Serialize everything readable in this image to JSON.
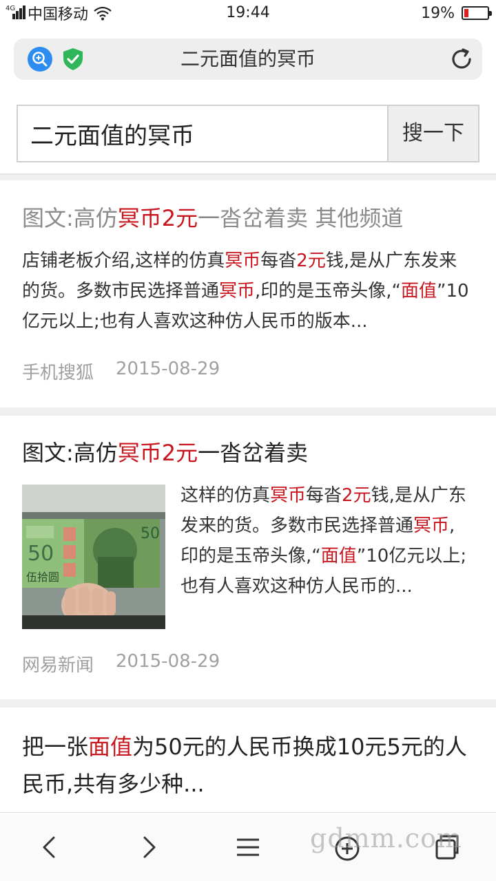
{
  "status_bar": {
    "network": "4G",
    "carrier": "中国移动",
    "time": "19:44",
    "battery_percent": "19%",
    "battery_level": 0.19
  },
  "address_bar": {
    "title": "二元面值的冥币"
  },
  "search": {
    "query": "二元面值的冥币",
    "button_label": "搜一下"
  },
  "results": [
    {
      "title_parts": [
        "图文:高仿",
        "冥币2元",
        "一沓岔着卖 其他频道"
      ],
      "snippet_parts": [
        "店铺老板介绍,这样的仿真",
        "冥币",
        "每沓",
        "2元",
        "钱,是从广东发来的货。多数市民选择普通",
        "冥币",
        ",印的是玉帝头像,“",
        "面值",
        "”10亿元以上;也有人喜欢这种仿人民币的版本..."
      ],
      "source": "手机搜狐",
      "date": "2015-08-29"
    },
    {
      "title_parts": [
        "图文:高仿",
        "冥币2元",
        "一沓岔着卖"
      ],
      "snippet_parts": [
        "这样的仿真",
        "冥币",
        "每沓",
        "2元",
        "钱,是从广东发来的货。多数市民选择普通",
        "冥币",
        ",印的是玉帝头像,“",
        "面值",
        "”10亿元以上;也有人喜欢这种仿人民币的..."
      ],
      "source": "网易新闻",
      "date": "2015-08-29"
    },
    {
      "title_parts": [
        "把一张",
        "面值",
        "为50元的人民币换成10元5元的人民币,共有多少种..."
      ]
    }
  ],
  "thumbnail": {
    "banknote_text": "50",
    "banknote_label": "伍拾圆"
  },
  "watermark": "gdmm.com",
  "colors": {
    "highlight": "#c8151d",
    "visited_title": "#8a8a8a",
    "meta": "#a0a0a0",
    "browser_blue": "#2d8cf0",
    "shield_green": "#2fb55a"
  },
  "icons": [
    "search-zoom-icon",
    "shield-check-icon",
    "refresh-icon",
    "back-arrow-icon",
    "forward-arrow-icon",
    "menu-icon",
    "home-icon",
    "tabs-icon"
  ]
}
